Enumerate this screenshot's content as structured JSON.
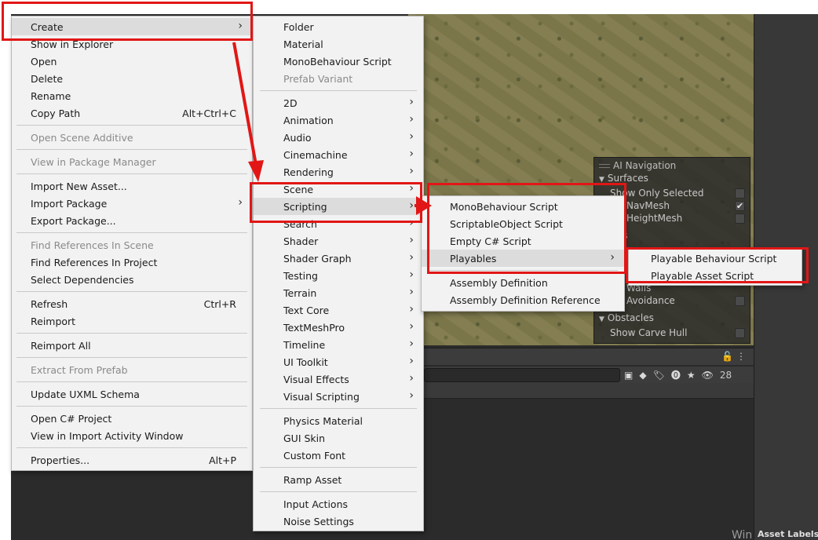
{
  "accent_color": "#e21616",
  "menu_root": {
    "items": [
      {
        "label": "Create",
        "has_submenu": true
      },
      {
        "label": "Show in Explorer"
      },
      {
        "label": "Open"
      },
      {
        "label": "Delete"
      },
      {
        "label": "Rename"
      },
      {
        "label": "Copy Path",
        "shortcut": "Alt+Ctrl+C"
      },
      {
        "label": "Open Scene Additive",
        "disabled": true
      },
      {
        "label": "View in Package Manager",
        "disabled": true
      },
      {
        "label": "Import New Asset..."
      },
      {
        "label": "Import Package",
        "has_submenu": true
      },
      {
        "label": "Export Package..."
      },
      {
        "label": "Find References In Scene",
        "disabled": true
      },
      {
        "label": "Find References In Project"
      },
      {
        "label": "Select Dependencies"
      },
      {
        "label": "Refresh",
        "shortcut": "Ctrl+R"
      },
      {
        "label": "Reimport"
      },
      {
        "label": "Reimport All"
      },
      {
        "label": "Extract From Prefab",
        "disabled": true
      },
      {
        "label": "Update UXML Schema"
      },
      {
        "label": "Open C# Project"
      },
      {
        "label": "View in Import Activity Window"
      },
      {
        "label": "Properties...",
        "shortcut": "Alt+P"
      }
    ]
  },
  "menu_create": {
    "items": [
      {
        "label": "Folder"
      },
      {
        "label": "Material"
      },
      {
        "label": "MonoBehaviour Script"
      },
      {
        "label": "Prefab Variant",
        "disabled": true
      },
      {
        "label": "2D",
        "has_submenu": true
      },
      {
        "label": "Animation",
        "has_submenu": true
      },
      {
        "label": "Audio",
        "has_submenu": true
      },
      {
        "label": "Cinemachine",
        "has_submenu": true
      },
      {
        "label": "Rendering",
        "has_submenu": true
      },
      {
        "label": "Scene",
        "has_submenu": true
      },
      {
        "label": "Scripting",
        "has_submenu": true
      },
      {
        "label": "Search",
        "has_submenu": true
      },
      {
        "label": "Shader",
        "has_submenu": true
      },
      {
        "label": "Shader Graph",
        "has_submenu": true
      },
      {
        "label": "Testing",
        "has_submenu": true
      },
      {
        "label": "Terrain",
        "has_submenu": true
      },
      {
        "label": "Text Core",
        "has_submenu": true
      },
      {
        "label": "TextMeshPro",
        "has_submenu": true
      },
      {
        "label": "Timeline",
        "has_submenu": true
      },
      {
        "label": "UI Toolkit",
        "has_submenu": true
      },
      {
        "label": "Visual Effects",
        "has_submenu": true
      },
      {
        "label": "Visual Scripting",
        "has_submenu": true
      },
      {
        "label": "Physics Material"
      },
      {
        "label": "GUI Skin"
      },
      {
        "label": "Custom Font"
      },
      {
        "label": "Ramp Asset"
      },
      {
        "label": "Input Actions"
      },
      {
        "label": "Noise Settings"
      }
    ]
  },
  "menu_scripting": {
    "items": [
      {
        "label": "MonoBehaviour Script"
      },
      {
        "label": "ScriptableObject Script"
      },
      {
        "label": "Empty C# Script"
      },
      {
        "label": "Playables",
        "has_submenu": true
      },
      {
        "label": "Assembly Definition"
      },
      {
        "label": "Assembly Definition Reference"
      }
    ]
  },
  "menu_playables": {
    "items": [
      {
        "label": "Playable Behaviour Script"
      },
      {
        "label": "Playable Asset Script"
      }
    ]
  },
  "ai_navigation": {
    "title": "AI Navigation",
    "surfaces_label": "Surfaces",
    "show_only_selected": "Show Only Selected",
    "show_navmesh": "ow NavMesh",
    "show_navmesh_checked": "✔",
    "show_heightmesh": "ow HeightMesh",
    "agents_label": "nts",
    "show_walls": "ow Walls",
    "show_avoidance": "ow Avoidance",
    "obstacles_label": "Obstacles",
    "show_carve_hull": "Show Carve Hull"
  },
  "project_toolbar": {
    "hidden_count": "28"
  },
  "bottom": {
    "asset_labels": "Asset Labels",
    "watermark": "Win"
  }
}
